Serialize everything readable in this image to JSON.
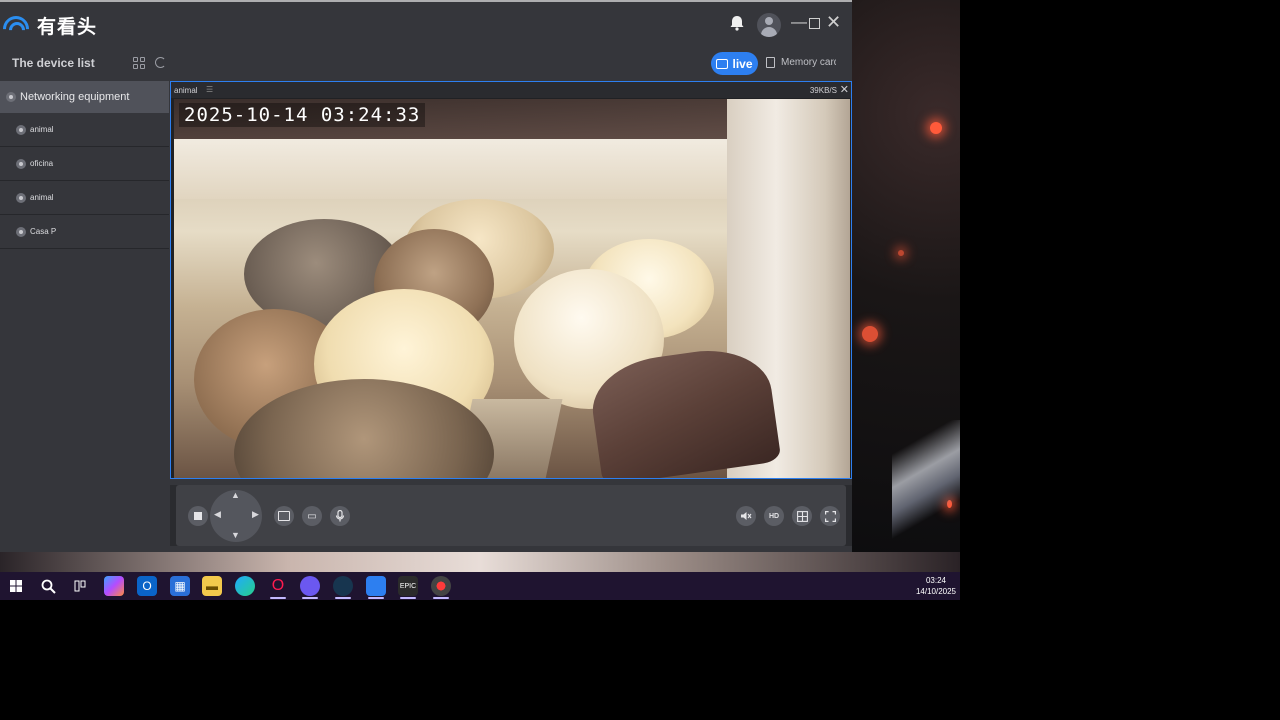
{
  "app": {
    "brand_name": "有看头",
    "device_list_title": "The device list",
    "live_label": "live",
    "memory_tab_label": "Memory card"
  },
  "sidebar": {
    "group_label": "Networking equipment",
    "items": [
      {
        "label": "animal"
      },
      {
        "label": "oficina"
      },
      {
        "label": "animal"
      },
      {
        "label": "Casa P"
      }
    ]
  },
  "player": {
    "channel_name": "animal",
    "bitrate": "39KB/S",
    "osd_timestamp": "2025-10-14   03:24:33",
    "hd_label": "HD"
  },
  "taskbar": {
    "time": "03:24",
    "date": "14/10/2025",
    "icons": [
      "windows-start-icon",
      "search-icon",
      "task-view-icon",
      "copilot-icon",
      "outlook-icon",
      "store-icon",
      "file-explorer-icon",
      "edge-icon",
      "opera-icon",
      "discord-icon",
      "steam-icon",
      "camera-app-icon",
      "epic-games-icon",
      "chrome-recorder-icon"
    ]
  },
  "colors": {
    "accent": "#2d7ff0",
    "app_bg": "#35363b",
    "taskbar_bg": "#1f1430"
  }
}
